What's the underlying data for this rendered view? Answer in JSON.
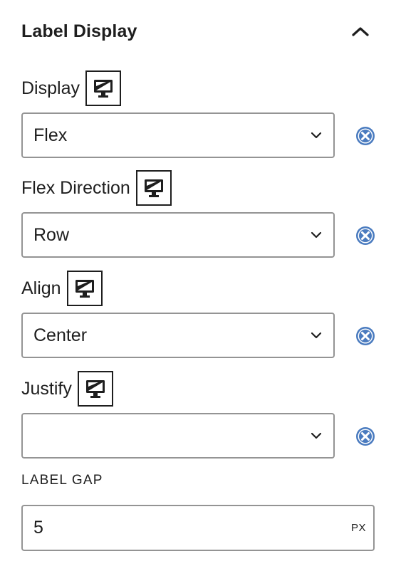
{
  "panel": {
    "title": "Label Display",
    "toggle_icon": "chevron-up-icon"
  },
  "fields": {
    "display": {
      "label": "Display",
      "value": "Flex",
      "device_icon": "desktop-icon",
      "clear_icon": "clear-circle-icon"
    },
    "flex_direction": {
      "label": "Flex Direction",
      "value": "Row",
      "device_icon": "desktop-icon",
      "clear_icon": "clear-circle-icon"
    },
    "align": {
      "label": "Align",
      "value": "Center",
      "device_icon": "desktop-icon",
      "clear_icon": "clear-circle-icon"
    },
    "justify": {
      "label": "Justify",
      "value": "",
      "device_icon": "desktop-icon",
      "clear_icon": "clear-circle-icon"
    }
  },
  "label_gap": {
    "label": "LABEL GAP",
    "value": "5",
    "unit": "PX"
  },
  "colors": {
    "text": "#1e1e1e",
    "border": "#949494",
    "clear_icon": "#4a7bbf"
  }
}
